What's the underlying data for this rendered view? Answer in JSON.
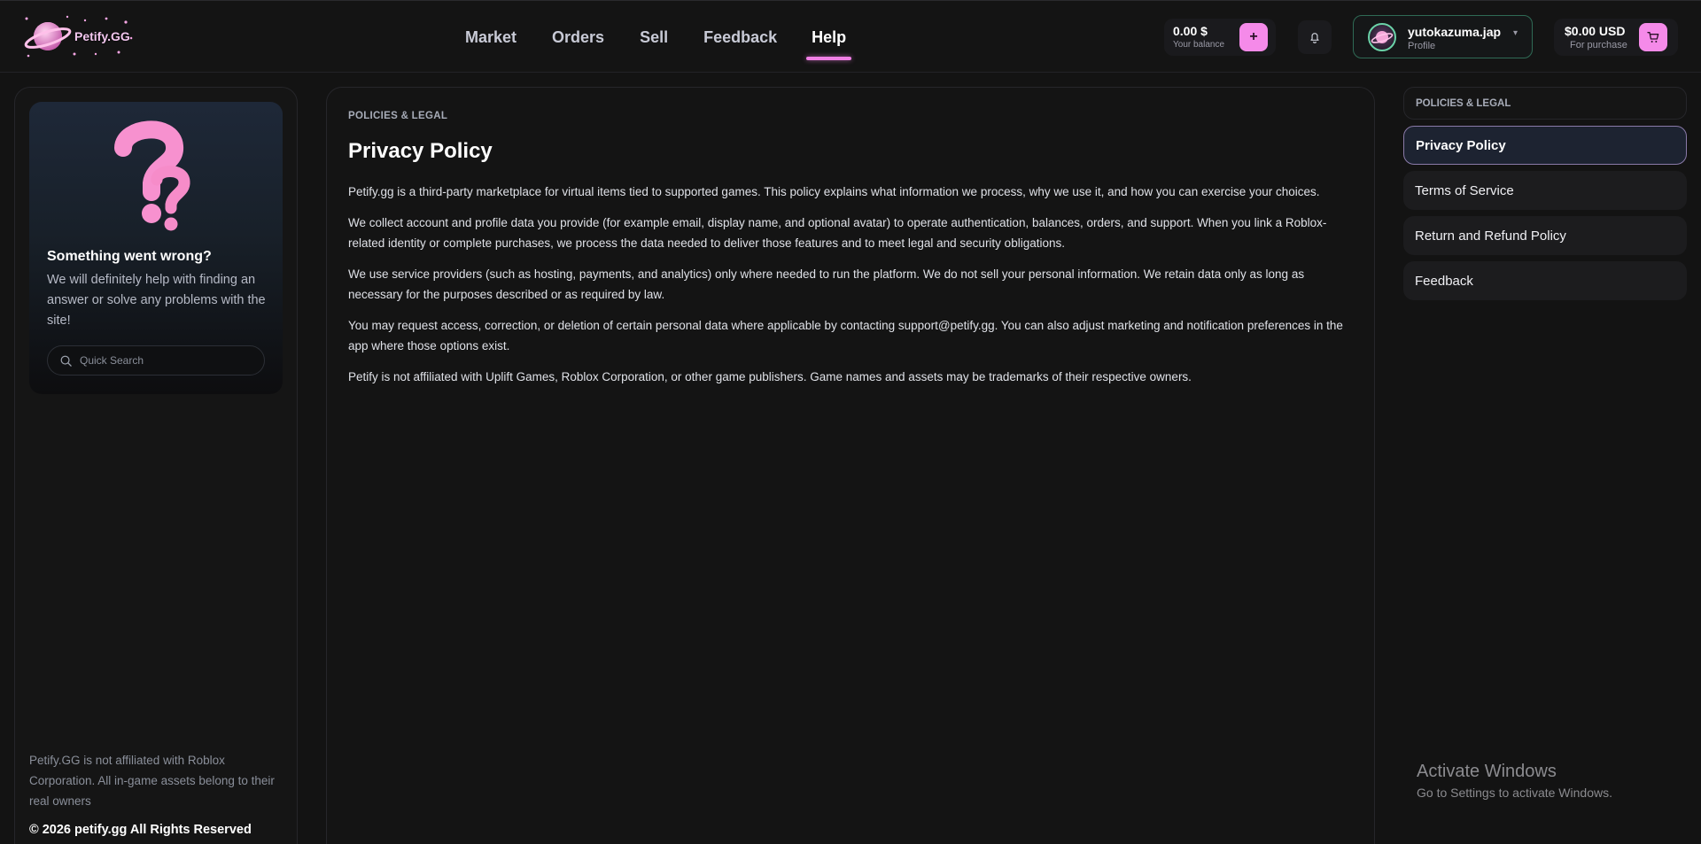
{
  "brand": {
    "name": "Petify.GG"
  },
  "nav": {
    "items": [
      {
        "label": "Market"
      },
      {
        "label": "Orders"
      },
      {
        "label": "Sell"
      },
      {
        "label": "Feedback"
      },
      {
        "label": "Help",
        "active": true
      }
    ]
  },
  "balance": {
    "amount": "0.00 $",
    "label": "Your balance",
    "add_label": "+"
  },
  "notifications": {
    "icon": "bell-icon"
  },
  "profile": {
    "name": "yutokazuma.jap",
    "sub": "Profile",
    "chevron": "▾"
  },
  "cart": {
    "amount": "$0.00 USD",
    "label": "For purchase",
    "icon": "cart-icon"
  },
  "help_card": {
    "title": "Something went wrong?",
    "text": "We will definitely help with finding an answer or solve any problems with the site!",
    "search_placeholder": "Quick Search"
  },
  "footer": {
    "disclaimer": "Petify.GG is not affiliated with Roblox Corporation. All in-game assets belong to their real owners",
    "copyright": "© 2026 petify.gg All Rights Reserved"
  },
  "main": {
    "breadcrumb": "POLICIES & LEGAL",
    "title": "Privacy Policy",
    "paragraphs": [
      "Petify.gg is a third-party marketplace for virtual items tied to supported games. This policy explains what information we process, why we use it, and how you can exercise your choices.",
      "We collect account and profile data you provide (for example email, display name, and optional avatar) to operate authentication, balances, orders, and support. When you link a Roblox-related identity or complete purchases, we process the data needed to deliver those features and to meet legal and security obligations.",
      "We use service providers (such as hosting, payments, and analytics) only where needed to run the platform. We do not sell your personal information. We retain data only as long as necessary for the purposes described or as required by law.",
      "You may request access, correction, or deletion of certain personal data where applicable by contacting support@petify.gg. You can also adjust marketing and notification preferences in the app where those options exist.",
      "Petify is not affiliated with Uplift Games, Roblox Corporation, or other game publishers. Game names and assets may be trademarks of their respective owners."
    ]
  },
  "right_nav": {
    "heading": "POLICIES & LEGAL",
    "items": [
      {
        "label": "Privacy Policy",
        "active": true
      },
      {
        "label": "Terms of Service"
      },
      {
        "label": "Return and Refund Policy"
      },
      {
        "label": "Feedback"
      }
    ]
  },
  "watermark": {
    "line1": "Activate Windows",
    "line2": "Go to Settings to activate Windows."
  },
  "colors": {
    "accent": "#f58ae9",
    "background": "#131313",
    "profile_border": "#2f6a55"
  }
}
